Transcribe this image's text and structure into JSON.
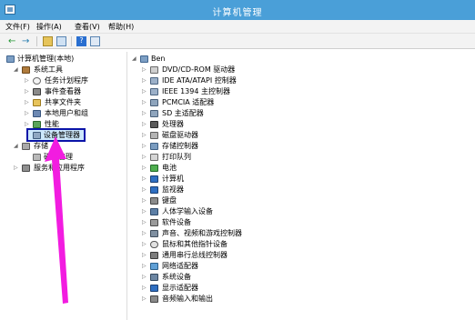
{
  "window": {
    "title": "计算机管理"
  },
  "menu": [
    {
      "label": "文件(F)"
    },
    {
      "label": "操作(A)"
    },
    {
      "label": "查看(V)"
    },
    {
      "label": "帮助(H)"
    }
  ],
  "toolbar": {
    "back_icon": "←",
    "forward_icon": "→",
    "help_icon": "?"
  },
  "left_tree": {
    "root": "计算机管理(本地)",
    "system_tools": "系统工具",
    "task_scheduler": "任务计划程序",
    "event_viewer": "事件查看器",
    "shared_folders": "共享文件夹",
    "local_users": "本地用户和组",
    "performance": "性能",
    "device_manager": "设备管理器",
    "storage": "存储",
    "disk_management": "磁盘管理",
    "services": "服务和应用程序"
  },
  "right_tree": {
    "root": "Ben",
    "items": [
      "DVD/CD-ROM 驱动器",
      "IDE ATA/ATAPI 控制器",
      "IEEE 1394 主控制器",
      "PCMCIA 适配器",
      "SD 主适配器",
      "处理器",
      "磁盘驱动器",
      "存储控制器",
      "打印队列",
      "电池",
      "计算机",
      "监视器",
      "键盘",
      "人体学输入设备",
      "软件设备",
      "声音、视频和游戏控制器",
      "鼠标和其他指针设备",
      "通用串行总线控制器",
      "网络适配器",
      "系统设备",
      "显示适配器",
      "音频输入和输出"
    ]
  },
  "colors": {
    "titlebar": "#4a9fd8",
    "highlight_border": "#0a14a8",
    "pointer_arrow": "#f21ce0"
  }
}
